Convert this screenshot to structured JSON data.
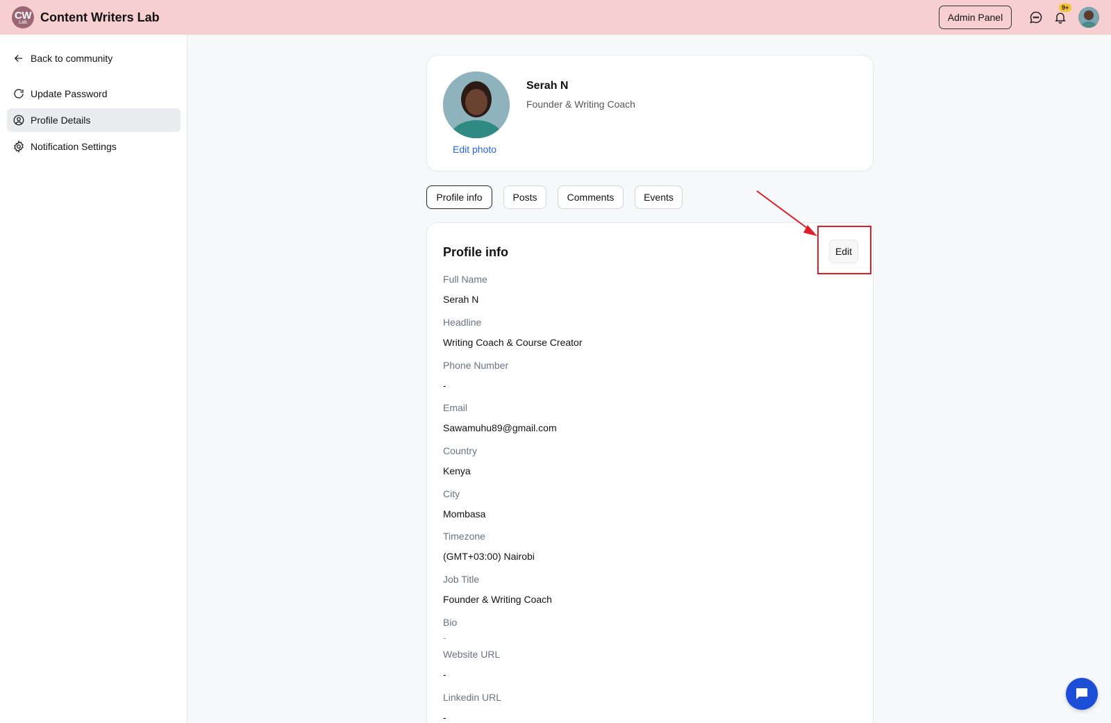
{
  "header": {
    "logo_text": "CW",
    "logo_subtext": "Lab",
    "app_name": "Content Writers Lab",
    "admin_label": "Admin Panel",
    "notification_badge": "9+",
    "bg_color": "#f7cfd1"
  },
  "sidebar": {
    "back_label": "Back to community",
    "items": [
      {
        "label": "Update Password",
        "icon": "refresh-icon",
        "active": false
      },
      {
        "label": "Profile Details",
        "icon": "user-circle-icon",
        "active": true
      },
      {
        "label": "Notification Settings",
        "icon": "gear-icon",
        "active": false
      }
    ]
  },
  "profile": {
    "name": "Serah N",
    "role": "Founder & Writing Coach",
    "edit_photo_label": "Edit photo"
  },
  "tabs": [
    {
      "label": "Profile info",
      "active": true
    },
    {
      "label": "Posts",
      "active": false
    },
    {
      "label": "Comments",
      "active": false
    },
    {
      "label": "Events",
      "active": false
    }
  ],
  "info": {
    "title": "Profile info",
    "edit_label": "Edit",
    "fields": [
      {
        "label": "Full Name",
        "value": "Serah N"
      },
      {
        "label": "Headline",
        "value": "Writing Coach & Course Creator"
      },
      {
        "label": "Phone Number",
        "value": "-"
      },
      {
        "label": "Email",
        "value": "Sawamuhu89@gmail.com"
      },
      {
        "label": "Country",
        "value": "Kenya"
      },
      {
        "label": "City",
        "value": "Mombasa"
      },
      {
        "label": "Timezone",
        "value": "(GMT+03:00) Nairobi"
      },
      {
        "label": "Job Title",
        "value": "Founder & Writing Coach"
      },
      {
        "label": "Bio",
        "value": "-"
      },
      {
        "label": "Website URL",
        "value": "-"
      },
      {
        "label": "Linkedin URL",
        "value": "-"
      }
    ]
  },
  "accent_color": "#2563eb",
  "annotation_color": "#e11d2a"
}
